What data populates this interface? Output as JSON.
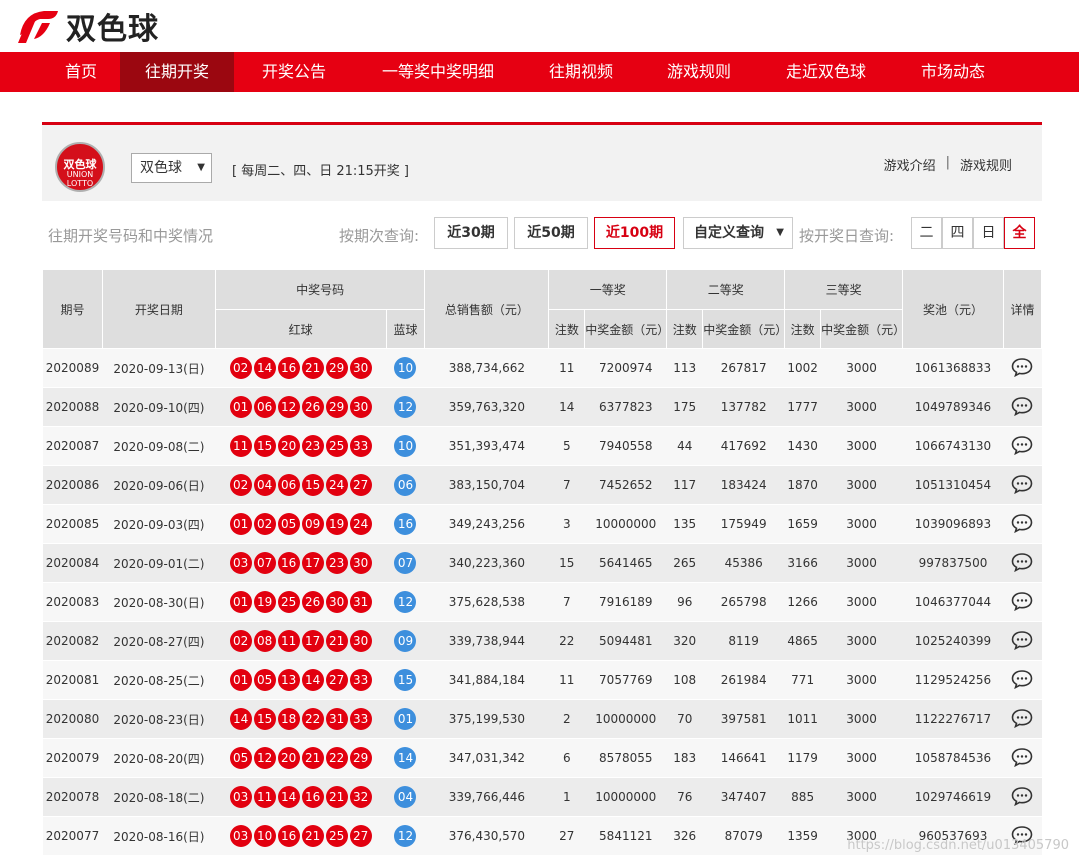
{
  "brand": {
    "title": "双色球",
    "accent": "#e60012"
  },
  "nav": [
    {
      "label": "首页",
      "width": 78,
      "active": false
    },
    {
      "label": "往期开奖",
      "width": 114,
      "active": true
    },
    {
      "label": "开奖公告",
      "width": 120,
      "active": false
    },
    {
      "label": "一等奖中奖明细",
      "width": 168,
      "active": false
    },
    {
      "label": "往期视频",
      "width": 118,
      "active": false
    },
    {
      "label": "游戏规则",
      "width": 118,
      "active": false
    },
    {
      "label": "走近双色球",
      "width": 136,
      "active": false
    },
    {
      "label": "市场动态",
      "width": 118,
      "active": false
    }
  ],
  "panel": {
    "logo_text": "双色球",
    "logo_sub": "UNION LOTTO",
    "select_value": "双色球",
    "schedule": "[ 每周二、四、日 21:15开奖 ]",
    "link_intro": "游戏介绍",
    "link_sep": "|",
    "link_rules": "游戏规则"
  },
  "query": {
    "title": "往期开奖号码和中奖情况",
    "by_period_label": "按期次查询:",
    "btn_30": "近30期",
    "btn_50": "近50期",
    "btn_100": "近100期",
    "btn_custom": "自定义查询",
    "by_day_label": "按开奖日查询:",
    "day_tue": "二",
    "day_thu": "四",
    "day_sun": "日",
    "day_all": "全"
  },
  "table": {
    "headers": {
      "issue": "期号",
      "date": "开奖日期",
      "numbers": "中奖号码",
      "red": "红球",
      "blue": "蓝球",
      "sales": "总销售额（元）",
      "first": "一等奖",
      "second": "二等奖",
      "third": "三等奖",
      "count": "注数",
      "amount": "中奖金额（元）",
      "pool": "奖池（元）",
      "detail": "详情"
    },
    "rows": [
      {
        "issue": "2020089",
        "date": "2020-09-13(日)",
        "red": [
          "02",
          "14",
          "16",
          "21",
          "29",
          "30"
        ],
        "blue": "10",
        "sales": "388,734,662",
        "c1": "11",
        "a1": "7200974",
        "c2": "113",
        "a2": "267817",
        "c3": "1002",
        "a3": "3000",
        "pool": "1061368833"
      },
      {
        "issue": "2020088",
        "date": "2020-09-10(四)",
        "red": [
          "01",
          "06",
          "12",
          "26",
          "29",
          "30"
        ],
        "blue": "12",
        "sales": "359,763,320",
        "c1": "14",
        "a1": "6377823",
        "c2": "175",
        "a2": "137782",
        "c3": "1777",
        "a3": "3000",
        "pool": "1049789346"
      },
      {
        "issue": "2020087",
        "date": "2020-09-08(二)",
        "red": [
          "11",
          "15",
          "20",
          "23",
          "25",
          "33"
        ],
        "blue": "10",
        "sales": "351,393,474",
        "c1": "5",
        "a1": "7940558",
        "c2": "44",
        "a2": "417692",
        "c3": "1430",
        "a3": "3000",
        "pool": "1066743130"
      },
      {
        "issue": "2020086",
        "date": "2020-09-06(日)",
        "red": [
          "02",
          "04",
          "06",
          "15",
          "24",
          "27"
        ],
        "blue": "06",
        "sales": "383,150,704",
        "c1": "7",
        "a1": "7452652",
        "c2": "117",
        "a2": "183424",
        "c3": "1870",
        "a3": "3000",
        "pool": "1051310454"
      },
      {
        "issue": "2020085",
        "date": "2020-09-03(四)",
        "red": [
          "01",
          "02",
          "05",
          "09",
          "19",
          "24"
        ],
        "blue": "16",
        "sales": "349,243,256",
        "c1": "3",
        "a1": "10000000",
        "c2": "135",
        "a2": "175949",
        "c3": "1659",
        "a3": "3000",
        "pool": "1039096893"
      },
      {
        "issue": "2020084",
        "date": "2020-09-01(二)",
        "red": [
          "03",
          "07",
          "16",
          "17",
          "23",
          "30"
        ],
        "blue": "07",
        "sales": "340,223,360",
        "c1": "15",
        "a1": "5641465",
        "c2": "265",
        "a2": "45386",
        "c3": "3166",
        "a3": "3000",
        "pool": "997837500"
      },
      {
        "issue": "2020083",
        "date": "2020-08-30(日)",
        "red": [
          "01",
          "19",
          "25",
          "26",
          "30",
          "31"
        ],
        "blue": "12",
        "sales": "375,628,538",
        "c1": "7",
        "a1": "7916189",
        "c2": "96",
        "a2": "265798",
        "c3": "1266",
        "a3": "3000",
        "pool": "1046377044"
      },
      {
        "issue": "2020082",
        "date": "2020-08-27(四)",
        "red": [
          "02",
          "08",
          "11",
          "17",
          "21",
          "30"
        ],
        "blue": "09",
        "sales": "339,738,944",
        "c1": "22",
        "a1": "5094481",
        "c2": "320",
        "a2": "8119",
        "c3": "4865",
        "a3": "3000",
        "pool": "1025240399"
      },
      {
        "issue": "2020081",
        "date": "2020-08-25(二)",
        "red": [
          "01",
          "05",
          "13",
          "14",
          "27",
          "33"
        ],
        "blue": "15",
        "sales": "341,884,184",
        "c1": "11",
        "a1": "7057769",
        "c2": "108",
        "a2": "261984",
        "c3": "771",
        "a3": "3000",
        "pool": "1129524256"
      },
      {
        "issue": "2020080",
        "date": "2020-08-23(日)",
        "red": [
          "14",
          "15",
          "18",
          "22",
          "31",
          "33"
        ],
        "blue": "01",
        "sales": "375,199,530",
        "c1": "2",
        "a1": "10000000",
        "c2": "70",
        "a2": "397581",
        "c3": "1011",
        "a3": "3000",
        "pool": "1122276717"
      },
      {
        "issue": "2020079",
        "date": "2020-08-20(四)",
        "red": [
          "05",
          "12",
          "20",
          "21",
          "22",
          "29"
        ],
        "blue": "14",
        "sales": "347,031,342",
        "c1": "6",
        "a1": "8578055",
        "c2": "183",
        "a2": "146641",
        "c3": "1179",
        "a3": "3000",
        "pool": "1058784536"
      },
      {
        "issue": "2020078",
        "date": "2020-08-18(二)",
        "red": [
          "03",
          "11",
          "14",
          "16",
          "21",
          "32"
        ],
        "blue": "04",
        "sales": "339,766,446",
        "c1": "1",
        "a1": "10000000",
        "c2": "76",
        "a2": "347407",
        "c3": "885",
        "a3": "3000",
        "pool": "1029746619"
      },
      {
        "issue": "2020077",
        "date": "2020-08-16(日)",
        "red": [
          "03",
          "10",
          "16",
          "21",
          "25",
          "27"
        ],
        "blue": "12",
        "sales": "376,430,570",
        "c1": "27",
        "a1": "5841121",
        "c2": "326",
        "a2": "87079",
        "c3": "1359",
        "a3": "3000",
        "pool": "960537693"
      }
    ]
  },
  "watermark": "https://blog.csdn.net/u013405790"
}
